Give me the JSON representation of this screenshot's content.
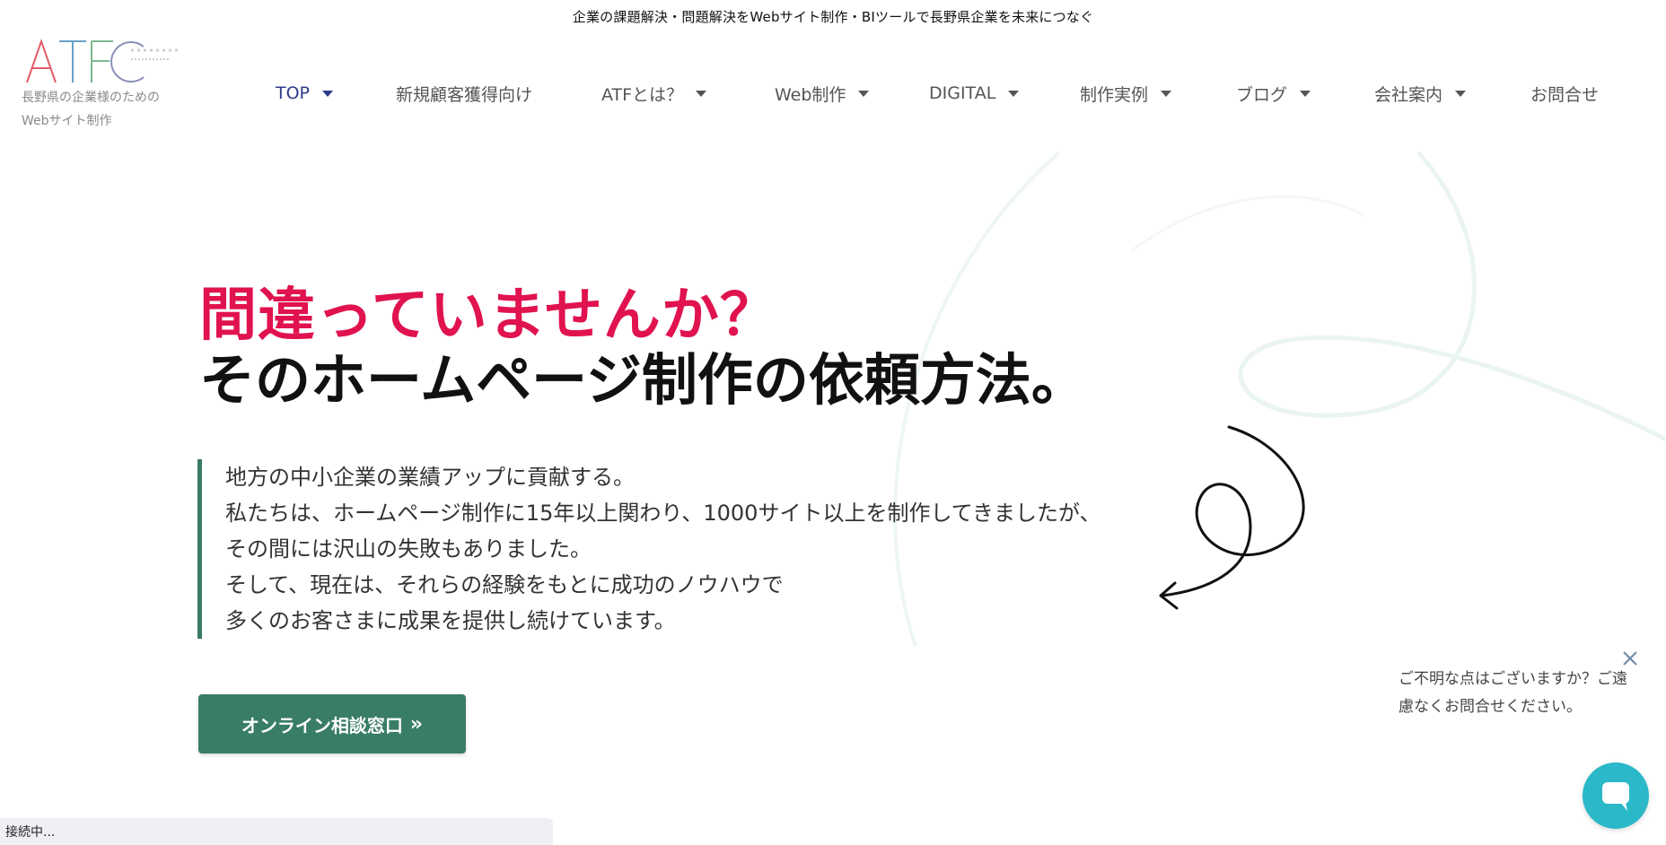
{
  "header": {
    "tagline": "企業の課題解決・問題解決をWebサイト制作・BIツールで長野県企業を未来につなぐ",
    "logo_text": "ATFC",
    "logo_sub_line1": "長野県の企業様のための",
    "logo_sub_line2": "Webサイト制作"
  },
  "nav": {
    "items": [
      {
        "label": "TOP",
        "dropdown": true,
        "active": true
      },
      {
        "label": "新規顧客獲得向け",
        "dropdown": false
      },
      {
        "label": "ATFとは？",
        "dropdown": true
      },
      {
        "label": "Web制作",
        "dropdown": true
      },
      {
        "label": "DIGITAL",
        "dropdown": true
      },
      {
        "label": "制作実例",
        "dropdown": true
      },
      {
        "label": "ブログ",
        "dropdown": true
      },
      {
        "label": "会社案内",
        "dropdown": true
      },
      {
        "label": "お問合せ",
        "dropdown": false
      }
    ]
  },
  "hero": {
    "title_line1": "間違っていませんか？",
    "title_line2": "そのホームページ制作の依頼方法。",
    "description": [
      "地方の中小企業の業績アップに貢献する。",
      "私たちは、ホームページ制作に15年以上関わり、1000サイト以上を制作してきましたが、",
      "その間には沢山の失敗もありました。",
      "そして、現在は、それらの経験をもとに成功のノウハウで",
      "多くのお客さまに成果を提供し続けています。"
    ],
    "cta_label": "オンライン相談窓口",
    "cta_icon": "»"
  },
  "chat": {
    "message": "ご不明な点はございますか？ご遠慮なくお問合せください。"
  },
  "status_bar": {
    "text": "接続中..."
  },
  "colors": {
    "accent_pink": "#e0134f",
    "nav_active": "#2d3a8c",
    "cta_green": "#3a7d65",
    "chat_teal": "#2bb8c9"
  }
}
